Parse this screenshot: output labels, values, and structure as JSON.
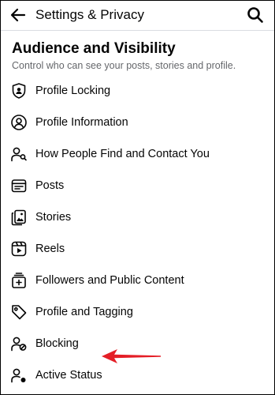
{
  "header": {
    "title": "Settings & Privacy",
    "back_icon": "arrow-left-icon",
    "search_icon": "search-icon"
  },
  "section": {
    "title": "Audience and Visibility",
    "subtitle": "Control who can see your posts, stories and profile."
  },
  "items": [
    {
      "label": "Profile Locking",
      "icon": "shield-person-icon"
    },
    {
      "label": "Profile Information",
      "icon": "person-circle-icon"
    },
    {
      "label": "How People Find and Contact You",
      "icon": "person-search-icon"
    },
    {
      "label": "Posts",
      "icon": "post-card-icon"
    },
    {
      "label": "Stories",
      "icon": "stories-icon"
    },
    {
      "label": "Reels",
      "icon": "reels-icon"
    },
    {
      "label": "Followers and Public Content",
      "icon": "followers-icon"
    },
    {
      "label": "Profile and Tagging",
      "icon": "tag-icon"
    },
    {
      "label": "Blocking",
      "icon": "person-block-icon"
    },
    {
      "label": "Active Status",
      "icon": "person-active-icon"
    }
  ],
  "annotation": {
    "arrow_color": "#e41e26",
    "points_to": "Active Status"
  },
  "colors": {
    "text": "#050505",
    "secondary_text": "#65676b",
    "divider": "#dadde1"
  }
}
